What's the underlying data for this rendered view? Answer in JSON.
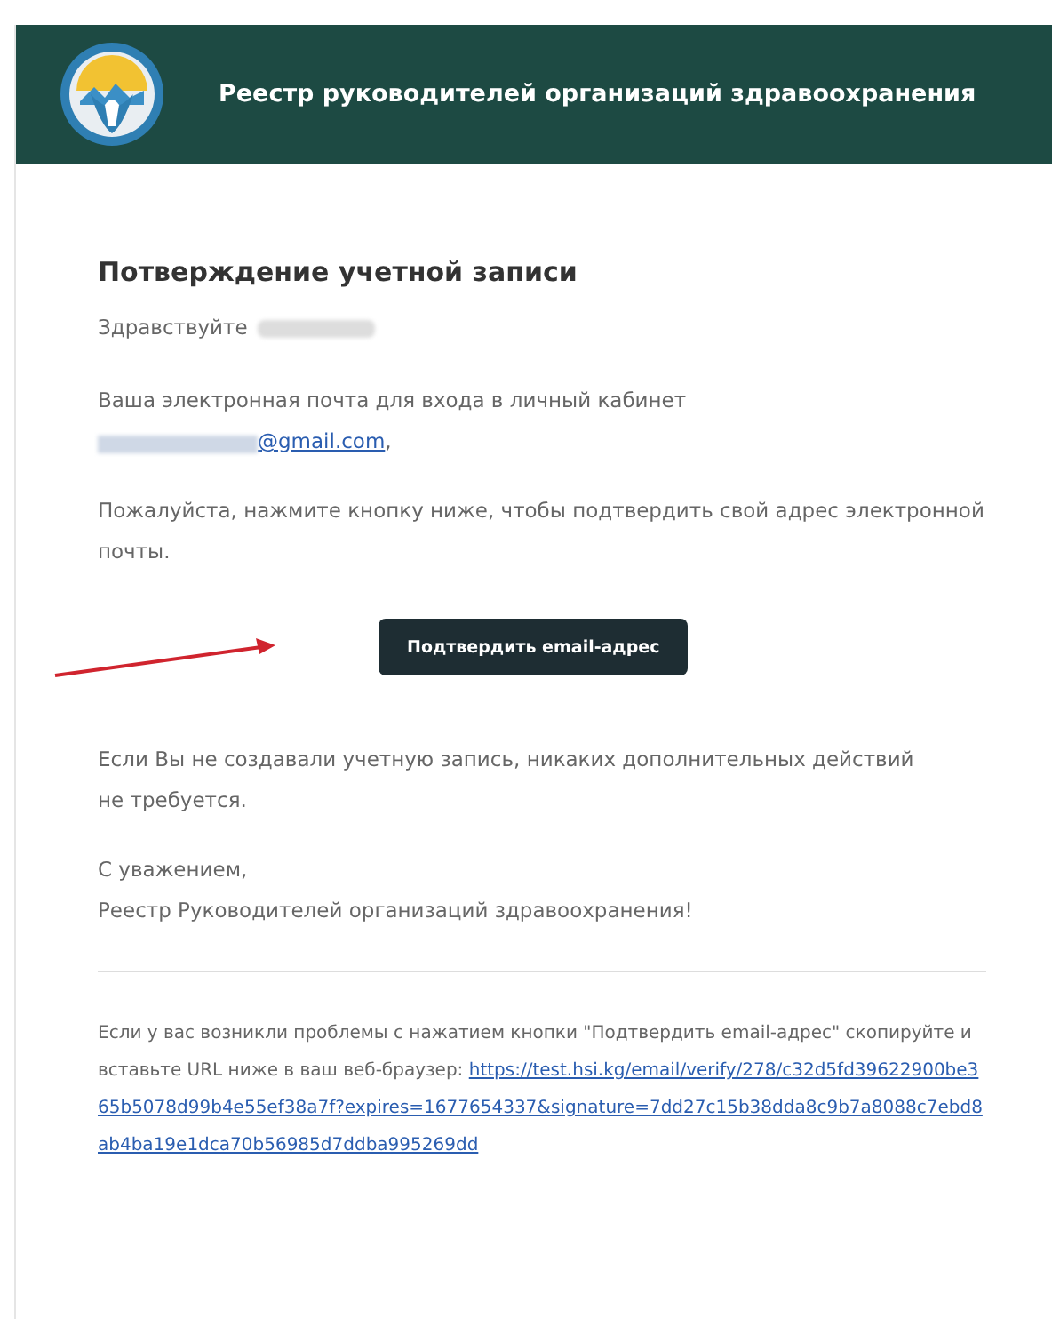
{
  "header": {
    "title": "Реестр руководителей организаций здравоохранения"
  },
  "email": {
    "heading": "Потверждение учетной записи",
    "greeting": "Здравствуйте",
    "intro": "Ваша электронная почта для входа в личный кабинет",
    "address": "@gmail.com",
    "address_suffix": ",",
    "request": "Пожалуйста, нажмите кнопку ниже, чтобы подтвердить свой адрес электронной почты.",
    "button": "Подтвердить email-адрес",
    "notice": "Если Вы не создавали учетную запись, никаких дополнительных действий не требуется.",
    "regards": "С уважением,",
    "signature": "Реестр Руководителей организаций здравоохранения!",
    "footer_text": "Если у вас возникли проблемы с нажатием кнопки \"Подтвердить email-адрес\" скопируйте и вставьте URL ниже в ваш веб-браузер:",
    "footer_link": "https://test.hsi.kg/email/verify/278/c32d5fd39622900be365b5078d99b4e55ef38a7f?expires=1677654337&signature=7dd27c15b38dda8c9b7a8088c7ebd8ab4ba19e1dca70b56985d7ddba995269dd"
  }
}
